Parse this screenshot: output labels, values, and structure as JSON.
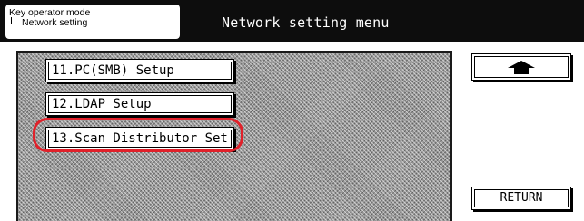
{
  "header": {
    "breadcrumb_line1": "Key operator mode",
    "breadcrumb_line2": "Network setting",
    "title": "Network setting menu"
  },
  "menu": {
    "items": [
      {
        "label": "11.PC(SMB) Setup"
      },
      {
        "label": "12.LDAP Setup"
      },
      {
        "label": "13.Scan Distributor Set",
        "highlighted": true
      }
    ]
  },
  "controls": {
    "up_icon": "up-arrow-icon",
    "return_label": "RETURN"
  },
  "colors": {
    "header_bg": "#0d0d0d",
    "highlight": "#e0212a"
  }
}
